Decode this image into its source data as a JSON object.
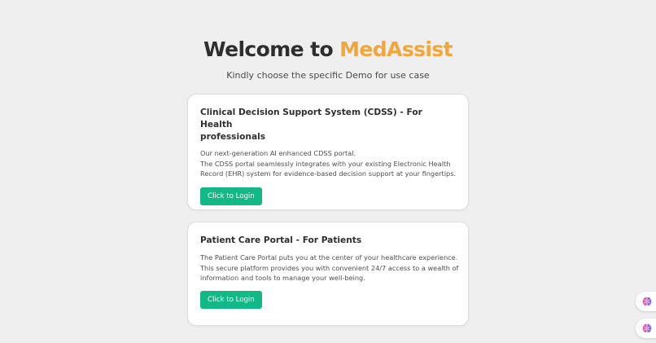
{
  "header": {
    "title_prefix": "Welcome to ",
    "title_brand": "MedAssist",
    "subtitle": "Kindly choose the specific Demo for use case"
  },
  "colors": {
    "brand": "#f2a63a",
    "button": "#12b886",
    "background": "#efefef"
  },
  "cards": [
    {
      "title_line1": "Clinical Decision Support System (CDSS) - For Health",
      "title_line2": "professionals",
      "desc": [
        "Our next-generation AI enhanced CDSS portal.",
        "The CDSS portal seamlessly integrates with your existing Electronic Health",
        "Record (EHR) system for evidence-based decision support at your fingertips."
      ],
      "button_label": "Click to Login"
    },
    {
      "title_line1": "Patient Care Portal - For Patients",
      "desc": [
        "The Patient Care Portal puts you at the center of your healthcare experience.",
        "This secure platform provides you with convenient 24/7 access to a wealth of",
        "information and tools to manage your well-being."
      ],
      "button_label": "Click to Login"
    }
  ],
  "floating_buttons": [
    {
      "icon": "brain-icon"
    },
    {
      "icon": "brain-icon"
    }
  ]
}
